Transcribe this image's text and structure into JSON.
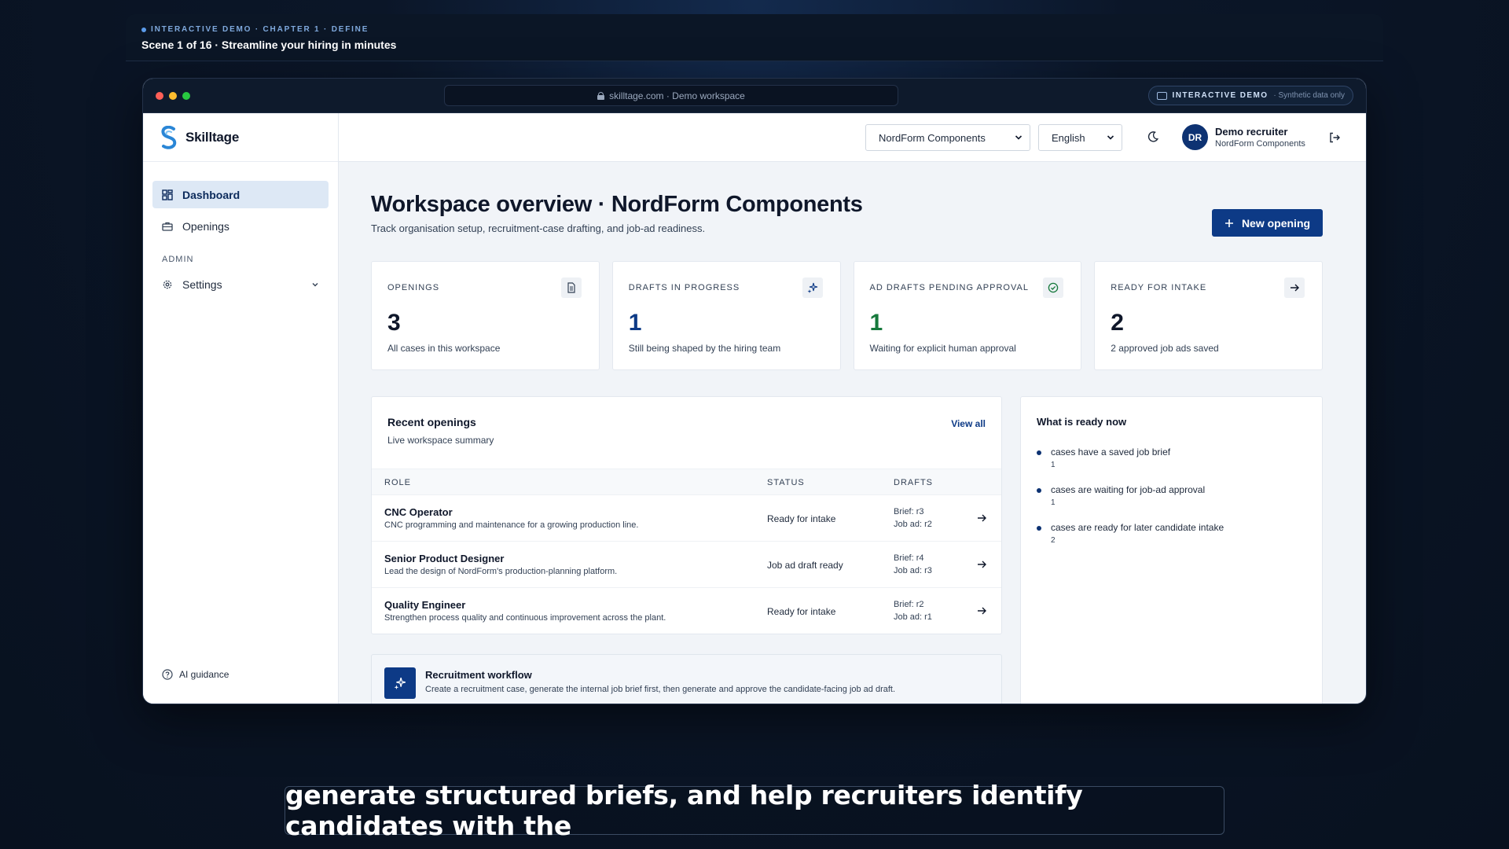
{
  "scene": {
    "kicker": "INTERACTIVE DEMO · CHAPTER 1 · DEFINE",
    "title": "Scene 1 of 16 · Streamline your hiring in minutes"
  },
  "browser": {
    "url": "skilltage.com · Demo workspace",
    "demo_badge": "INTERACTIVE DEMO",
    "demo_note": "· Synthetic data only"
  },
  "brand": {
    "name": "Skilltage",
    "accent": "#0d3a86"
  },
  "sidebar": {
    "items": [
      {
        "label": "Dashboard",
        "icon": "dashboard-icon",
        "active": true
      },
      {
        "label": "Openings",
        "icon": "briefcase-icon",
        "active": false
      }
    ],
    "section": "ADMIN",
    "settings": {
      "label": "Settings",
      "icon": "gear-icon"
    },
    "footer": "AI guidance"
  },
  "topbar": {
    "org_select": "NordForm Components",
    "lang_select": "English",
    "user": {
      "initials": "DR",
      "name": "Demo recruiter",
      "org": "NordForm Components"
    }
  },
  "page": {
    "title": "Workspace overview · NordForm Components",
    "subtitle": "Track organisation setup, recruitment-case drafting, and job-ad readiness.",
    "new_button": "New opening"
  },
  "stats": [
    {
      "label": "OPENINGS",
      "value": "3",
      "desc": "All cases in this workspace",
      "icon": "document-icon"
    },
    {
      "label": "DRAFTS IN PROGRESS",
      "value": "1",
      "desc": "Still being shaped by the hiring team",
      "icon": "sparkle-icon"
    },
    {
      "label": "AD DRAFTS PENDING APPROVAL",
      "value": "1",
      "desc": "Waiting for explicit human approval",
      "icon": "check-circle-icon"
    },
    {
      "label": "READY FOR INTAKE",
      "value": "2",
      "desc": "2 approved job ads saved",
      "icon": "arrow-right-icon"
    }
  ],
  "recent": {
    "title": "Recent openings",
    "subtitle": "Live workspace summary",
    "view_all": "View all",
    "columns": [
      "ROLE",
      "STATUS",
      "DRAFTS"
    ],
    "rows": [
      {
        "role": "CNC Operator",
        "desc": "CNC programming and maintenance for a growing production line.",
        "status": "Ready for intake",
        "brief": "Brief: r3",
        "jobad": "Job ad: r2"
      },
      {
        "role": "Senior Product Designer",
        "desc": "Lead the design of NordForm's production-planning platform.",
        "status": "Job ad draft ready",
        "brief": "Brief: r4",
        "jobad": "Job ad: r3"
      },
      {
        "role": "Quality Engineer",
        "desc": "Strengthen process quality and continuous improvement across the plant.",
        "status": "Ready for intake",
        "brief": "Brief: r2",
        "jobad": "Job ad: r1"
      }
    ]
  },
  "ready": {
    "title": "What is ready now",
    "items": [
      {
        "text": "cases have a saved job brief",
        "count": "1"
      },
      {
        "text": "cases are waiting for job-ad approval",
        "count": "1"
      },
      {
        "text": "cases are ready for later candidate intake",
        "count": "2"
      }
    ]
  },
  "workflow": {
    "title": "Recruitment workflow",
    "desc": "Create a recruitment case, generate the internal job brief first, then generate and approve the candidate-facing job ad draft."
  },
  "caption": "generate structured briefs, and help recruiters identify candidates with the"
}
